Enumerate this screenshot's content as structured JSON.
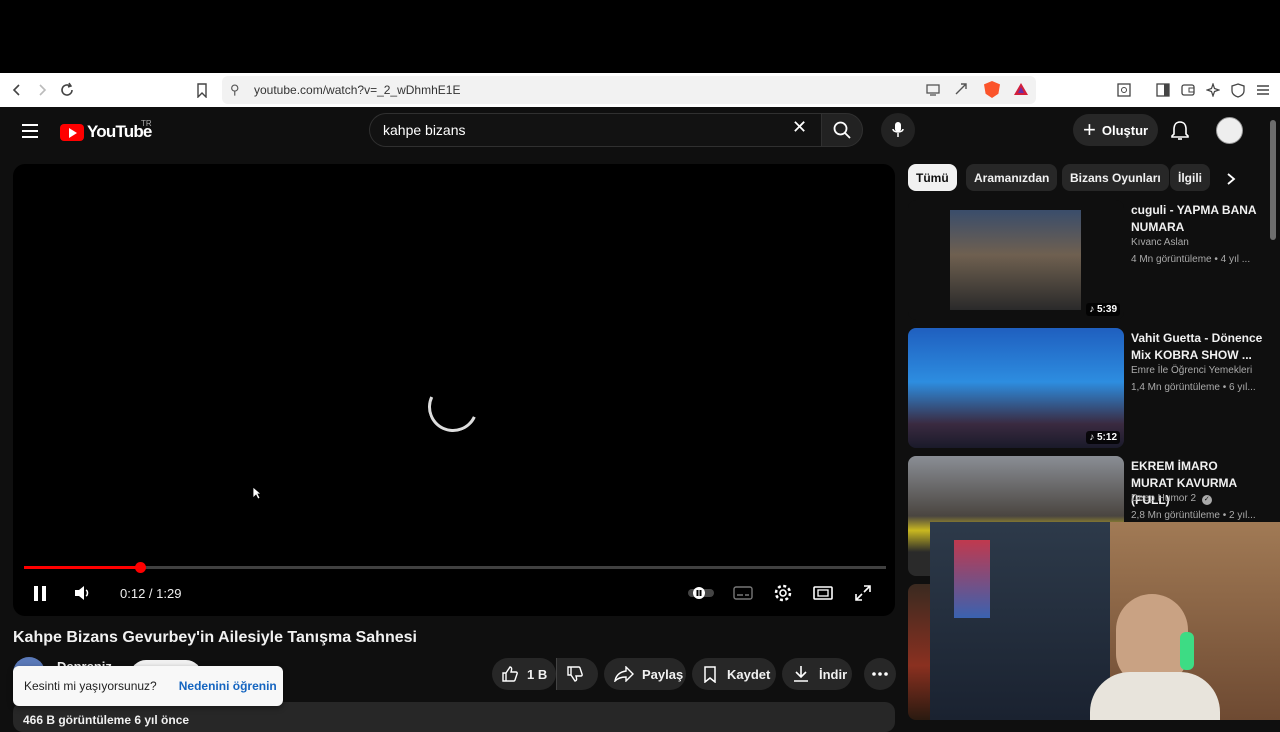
{
  "browser": {
    "url": "youtube.com/watch?v=_2_wDhmhE1E"
  },
  "header": {
    "logo_text": "YouTube",
    "logo_region": "TR",
    "search_value": "kahpe bizans",
    "create_label": "Oluştur"
  },
  "player": {
    "time": "0:12 / 1:29",
    "progress_fraction": 0.135
  },
  "video": {
    "title": "Kahpe Bizans Gevurbey'in Ailesiyle Tanışma Sahnesi",
    "channel": "Depreniz",
    "views": "466 B görüntüleme  6 yıl önce",
    "like_count": "1 B",
    "share_label": "Paylaş",
    "save_label": "Kaydet",
    "download_label": "İndir"
  },
  "toast": {
    "message": "Kesinti mi yaşıyorsunuz?",
    "link": "Nedenini öğrenin"
  },
  "chips": [
    "Tümü",
    "Aramanızdan",
    "Bizans Oyunları",
    "İlgili"
  ],
  "recommendations": [
    {
      "title": "cuguli - YAPMA BANA NUMARA",
      "channel": "Kıvanc Aslan",
      "meta": "4 Mn görüntüleme • 4 yıl ...",
      "duration": "5:39"
    },
    {
      "title": "Vahit Guetta - Dönence Mix KOBRA SHOW ...",
      "channel": "Emre İle Öğrenci Yemekleri",
      "meta": "1,4 Mn görüntüleme • 6 yıl...",
      "duration": "5:12"
    },
    {
      "title": "EKREM İMARO MURAT KAVURMA (FULL)",
      "channel": "Deep Humor 2",
      "meta": "2,8 Mn görüntüleme • 2 yıl...",
      "duration": ""
    }
  ],
  "colors": {
    "accent": "#ff0000",
    "link": "#1565c0",
    "background": "#0f0f0f"
  }
}
